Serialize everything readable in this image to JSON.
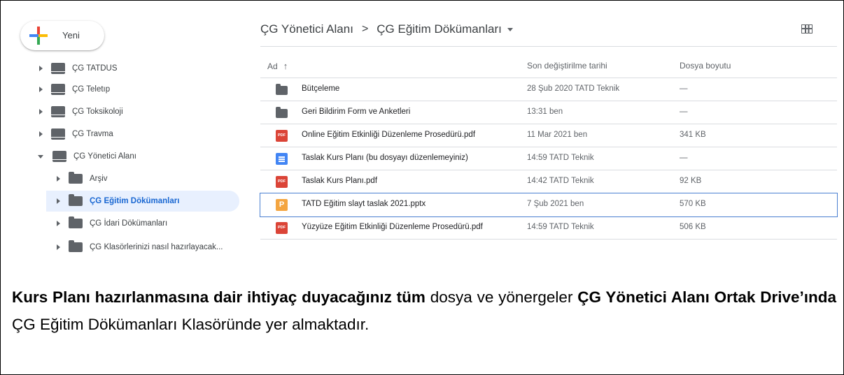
{
  "new_button": {
    "label": "Yeni"
  },
  "sidebar": {
    "items": [
      {
        "label": "ÇG TATDUS",
        "type": "drive",
        "expanded": false,
        "selected": false,
        "indent": 0
      },
      {
        "label": "ÇG Teletıp",
        "type": "drive",
        "expanded": false,
        "selected": false,
        "indent": 0
      },
      {
        "label": "ÇG Toksikoloji",
        "type": "drive",
        "expanded": false,
        "selected": false,
        "indent": 0
      },
      {
        "label": "ÇG Travma",
        "type": "drive",
        "expanded": false,
        "selected": false,
        "indent": 0
      },
      {
        "label": "ÇG Yönetici Alanı",
        "type": "drive",
        "expanded": true,
        "selected": false,
        "indent": 0
      },
      {
        "label": "Arşiv",
        "type": "folder",
        "expanded": false,
        "selected": false,
        "indent": 1
      },
      {
        "label": "ÇG Eğitim Dökümanları",
        "type": "folder",
        "expanded": false,
        "selected": true,
        "indent": 1
      },
      {
        "label": "ÇG İdari Dökümanları",
        "type": "folder",
        "expanded": false,
        "selected": false,
        "indent": 1
      },
      {
        "label": "ÇG Klasörlerinizi nasıl hazırlayacak...",
        "type": "folder",
        "expanded": false,
        "selected": false,
        "indent": 1
      }
    ]
  },
  "breadcrumb": {
    "parent": "ÇG Yönetici Alanı",
    "separator": ">",
    "current": "ÇG Eğitim Dökümanları"
  },
  "table": {
    "headers": {
      "name": "Ad",
      "sort_arrow": "↑",
      "modified": "Son değiştirilme tarihi",
      "size": "Dosya boyutu"
    },
    "rows": [
      {
        "icon": "folder-icon",
        "name": "Bütçeleme",
        "modified": "28 Şub 2020 TATD Teknik",
        "size": "—"
      },
      {
        "icon": "folder-icon",
        "name": "Geri Bildirim Form ve Anketleri",
        "modified": "13:31 ben",
        "size": "—"
      },
      {
        "icon": "pdf-icon",
        "name": "Online Eğitim Etkinliği Düzenleme Prosedürü.pdf",
        "modified": "11 Mar 2021 ben",
        "size": "341 KB"
      },
      {
        "icon": "google-doc-icon",
        "name": "Taslak Kurs Planı (bu dosyayı düzenlemeyiniz)",
        "modified": "14:59 TATD Teknik",
        "size": "—"
      },
      {
        "icon": "pdf-icon",
        "name": "Taslak Kurs Planı.pdf",
        "modified": "14:42 TATD Teknik",
        "size": "92 KB"
      },
      {
        "icon": "pptx-icon",
        "name": "TATD Eğitim slayt taslak 2021.pptx",
        "modified": "7 Şub 2021 ben",
        "size": "570 KB",
        "selected": true
      },
      {
        "icon": "pdf-icon",
        "name": "Yüzyüze Eğitim Etkinliği Düzenleme Prosedürü.pdf",
        "modified": "14:59 TATD Teknik",
        "size": "506 KB"
      }
    ]
  },
  "caption": {
    "bold1": "Kurs Planı hazırlanmasına dair ihtiyaç duyacağınız tüm",
    "text1": " dosya ve yönergeler ",
    "bold2": "ÇG Yönetici Alanı Ortak Drive’ında",
    "text2": " ÇG Eğitim Dökümanları Klasöründe yer almaktadır."
  },
  "pdf_badge": "PDF",
  "ppt_badge": "P",
  "colors": {
    "selected_bg": "#e8f0fe",
    "selected_text": "#1967d2",
    "pdf": "#db4437",
    "doc": "#4285f4",
    "ppt": "#f4a540"
  }
}
